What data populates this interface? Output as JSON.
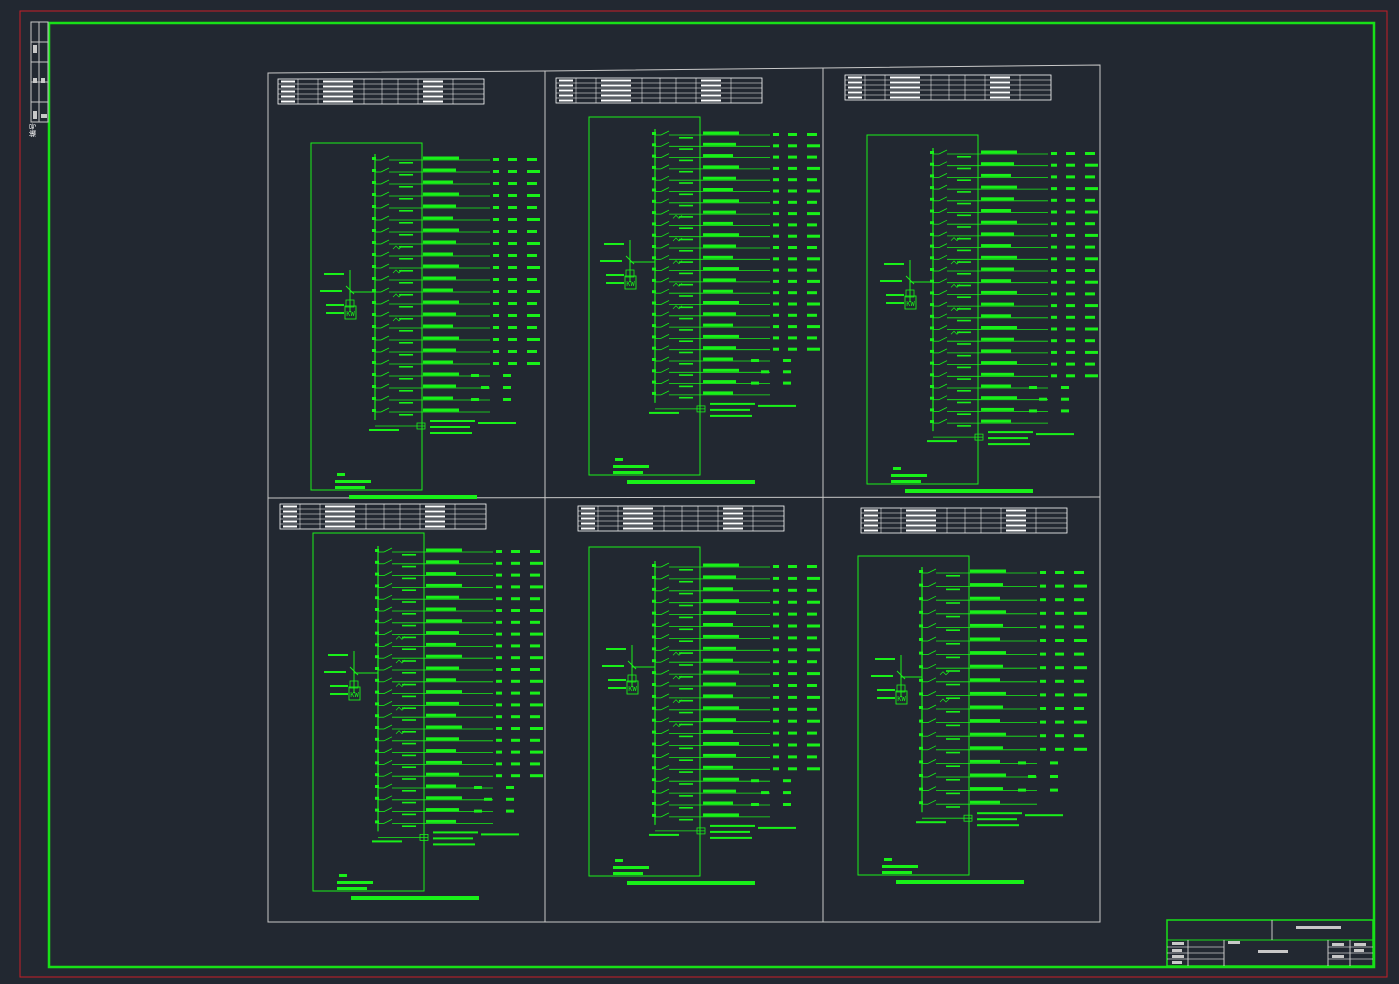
{
  "colors": {
    "background": "#222831",
    "outer_border": "#c81e28",
    "inner_border": "#18e018",
    "frame": "#c8c8c8",
    "drawing": "#19f019",
    "text": "#ffffff"
  },
  "sidebar": {
    "label": "编号"
  },
  "sheet": {
    "panel_count": 6,
    "panels": [
      {
        "id": "p1",
        "kw_label": "KW",
        "outgoing_circuits": 22
      },
      {
        "id": "p2",
        "kw_label": "KW",
        "outgoing_circuits": 24
      },
      {
        "id": "p3",
        "kw_label": "KW",
        "outgoing_circuits": 24
      },
      {
        "id": "p4",
        "kw_label": "KW",
        "outgoing_circuits": 24
      },
      {
        "id": "p5",
        "kw_label": "KW",
        "outgoing_circuits": 22
      },
      {
        "id": "p6",
        "kw_label": "KW",
        "outgoing_circuits": 18
      }
    ]
  },
  "title_block": {
    "present": true
  }
}
